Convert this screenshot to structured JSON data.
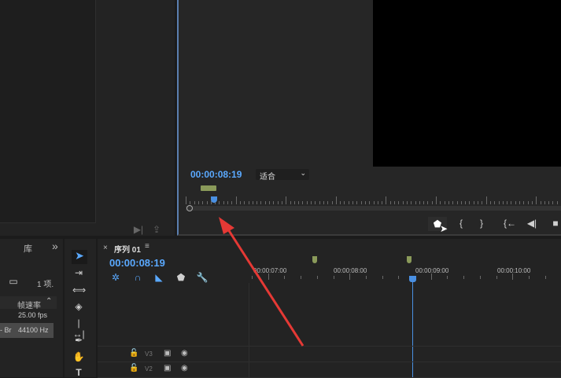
{
  "program_monitor": {
    "timecode": "00:00:08:19",
    "zoom_select": "适合",
    "accent": "#5aa9ff"
  },
  "project_panel": {
    "tab": "库",
    "overflow": "»",
    "item_count": "1 项.",
    "column_header": "帧速率",
    "rows": [
      {
        "name": "",
        "value": "25.00 fps"
      },
      {
        "name": "- Br",
        "value": "44100 Hz"
      }
    ]
  },
  "timeline": {
    "close": "×",
    "tab": "序列 01",
    "menu": "≡",
    "timecode": "00:00:08:19",
    "ruler_labels": [
      "00:00:07:00",
      "00:00:08:00",
      "00:00:09:00",
      "00:00:10:00"
    ],
    "tracks": [
      {
        "name": "V3"
      },
      {
        "name": "V2"
      }
    ]
  }
}
